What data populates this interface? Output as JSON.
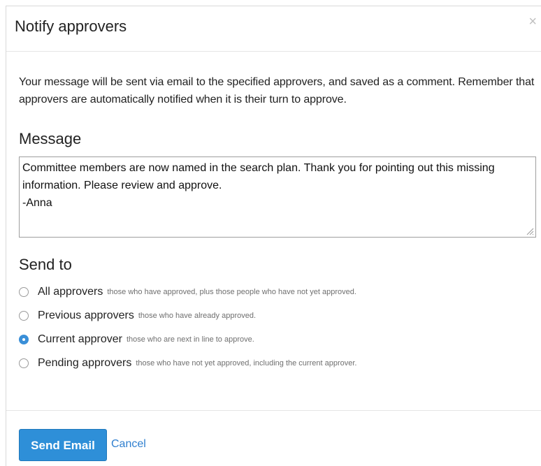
{
  "dialog": {
    "title": "Notify approvers",
    "close_glyph": "×",
    "intro": "Your message will be sent via email to the specified approvers, and saved as a comment. Remember that approvers are automatically notified when it is their turn to approve."
  },
  "message": {
    "label": "Message",
    "value": "Committee members are now named in the search plan. Thank you for pointing out this missing information. Please review and approve.\n-Anna"
  },
  "send_to": {
    "label": "Send to",
    "selected": "Current approver",
    "options": [
      {
        "label": "All approvers",
        "description": "those who have approved, plus those people who have not yet approved."
      },
      {
        "label": "Previous approvers",
        "description": "those who have already approved."
      },
      {
        "label": "Current approver",
        "description": "those who are next in line to approve."
      },
      {
        "label": "Pending approvers",
        "description": "those who have not yet approved, including the current approver."
      }
    ]
  },
  "footer": {
    "send_label": "Send Email",
    "cancel_label": "Cancel"
  },
  "colors": {
    "primary_button": "#2e8fd8",
    "link": "#2f7fcf",
    "radio_checked": "#3a8fd8"
  },
  "icons": {
    "close": "close-icon",
    "radio_unchecked": "radio-unchecked-icon",
    "radio_checked": "radio-checked-icon",
    "resize": "resize-grip-icon"
  }
}
